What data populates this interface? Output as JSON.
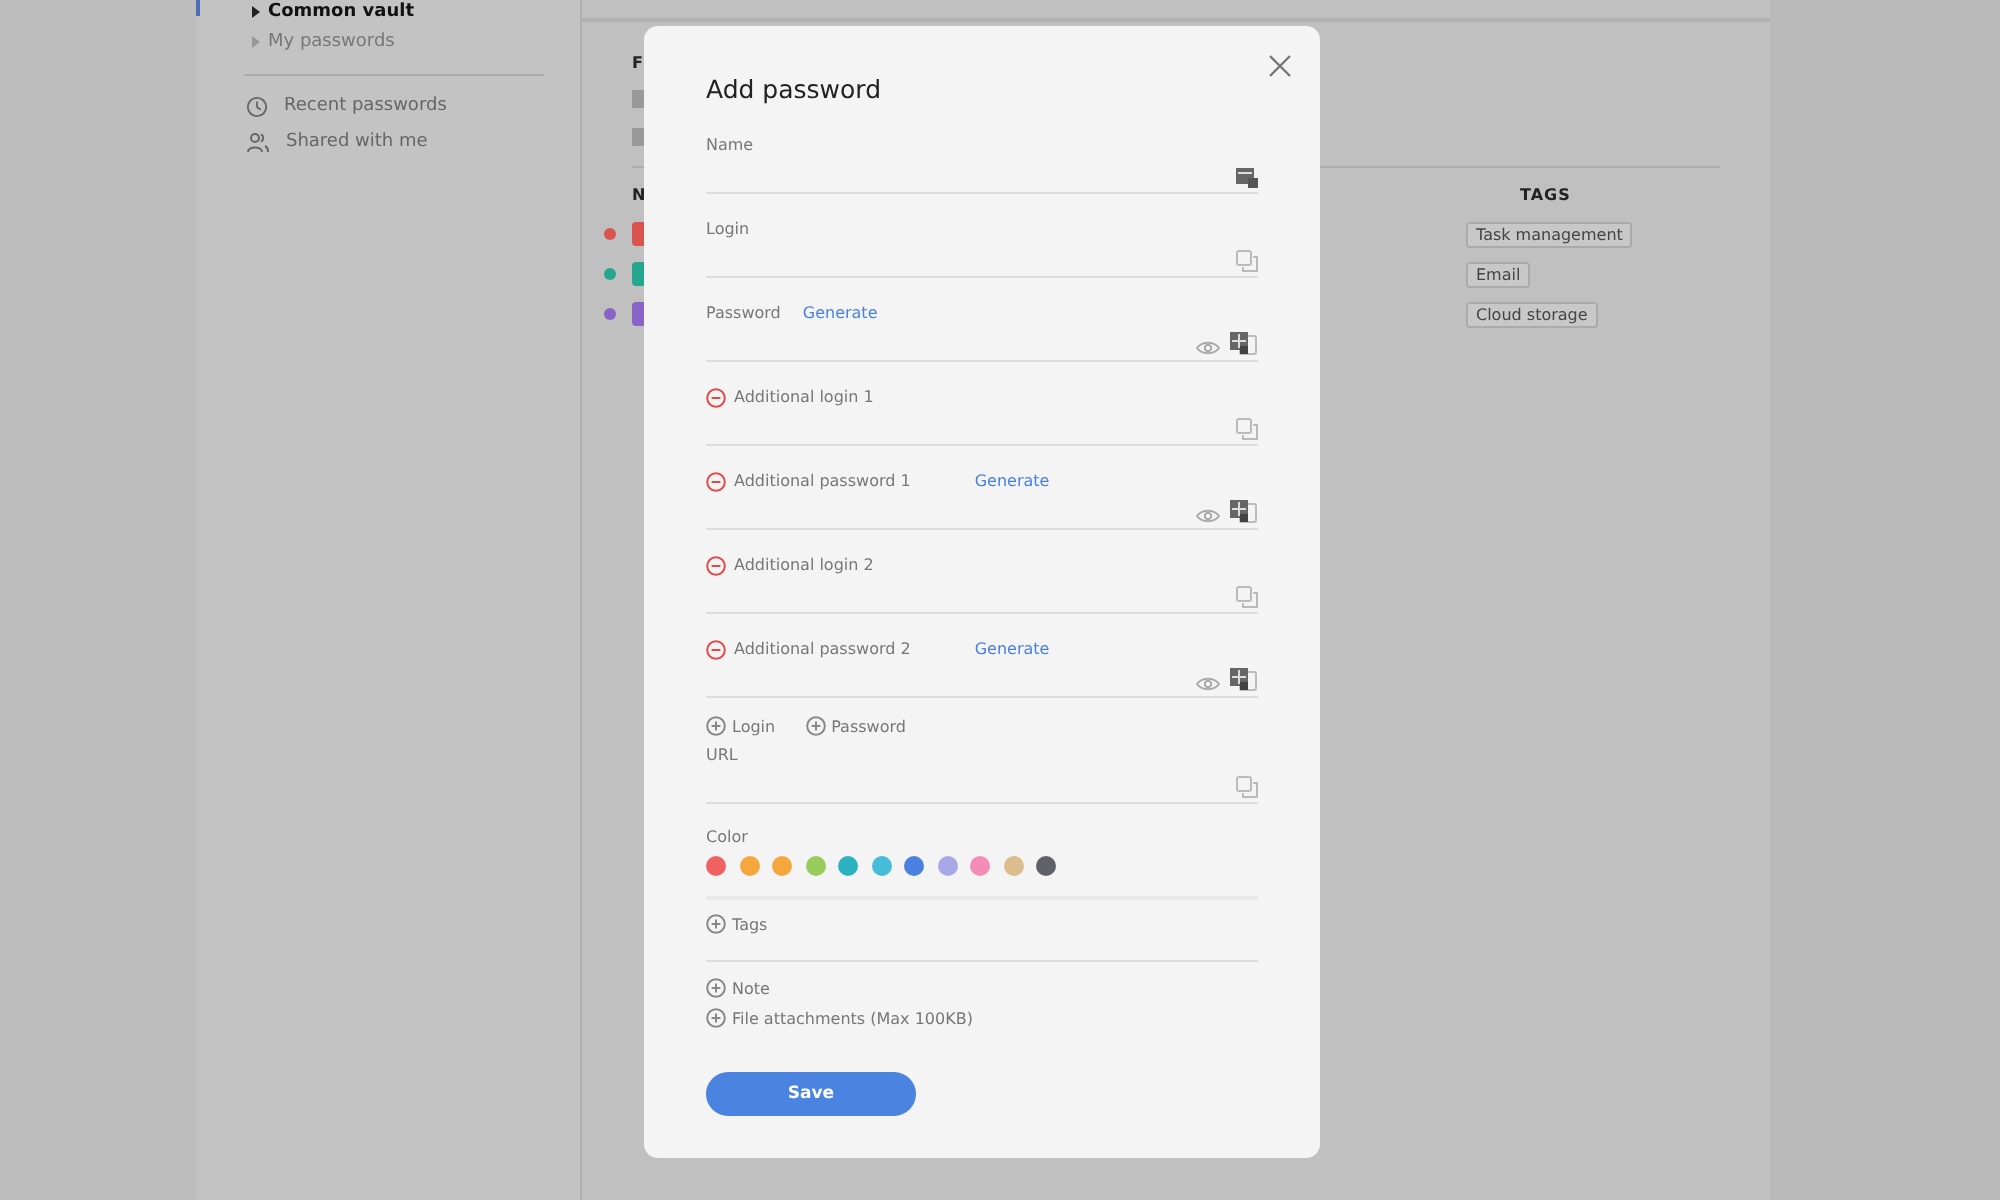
{
  "sidebar": {
    "vaults": [
      {
        "label": "Common vault",
        "selected": true
      },
      {
        "label": "My passwords",
        "selected": false
      }
    ],
    "links": [
      {
        "label": "Recent passwords",
        "kind": "recent"
      },
      {
        "label": "Shared with me",
        "kind": "shared"
      }
    ]
  },
  "main": {
    "folders_heading": "F",
    "list_heading": "N",
    "tags_heading": "TAGS",
    "rows": [
      {
        "color": "#d9534f",
        "tag": "Task management"
      },
      {
        "color": "#26a68f",
        "tag": "Email"
      },
      {
        "color": "#8a63c8",
        "tag": "Cloud storage"
      }
    ]
  },
  "dialog": {
    "title": "Add password",
    "fields": [
      {
        "label": "Name",
        "removable": false,
        "icons": [
          {
            "kind": "generator"
          }
        ]
      },
      {
        "label": "Login",
        "removable": false,
        "icons": [
          {
            "kind": "copy"
          }
        ]
      },
      {
        "label": "Password",
        "removable": false,
        "generate": "Generate",
        "icons": [
          {
            "kind": "eye"
          },
          {
            "kind": "generator-copy"
          }
        ]
      },
      {
        "label": "Additional login 1",
        "removable": true,
        "icons": [
          {
            "kind": "copy"
          }
        ]
      },
      {
        "label": "Additional password 1",
        "removable": true,
        "generate": "Generate",
        "icons": [
          {
            "kind": "eye"
          },
          {
            "kind": "generator-copy"
          }
        ]
      },
      {
        "label": "Additional login 2",
        "removable": true,
        "icons": [
          {
            "kind": "copy"
          }
        ]
      },
      {
        "label": "Additional password 2",
        "removable": true,
        "generate": "Generate",
        "icons": [
          {
            "kind": "eye"
          },
          {
            "kind": "generator-copy"
          }
        ]
      }
    ],
    "add_links": [
      "Login",
      "Password"
    ],
    "url": {
      "label": "URL",
      "icons": [
        {
          "kind": "copy"
        }
      ]
    },
    "color": {
      "label": "Color",
      "swatches": [
        {
          "color": "#f06262"
        },
        {
          "color": "#f5a63c"
        },
        {
          "color": "#f5a63c"
        },
        {
          "color": "#98cc5c"
        },
        {
          "color": "#2cb1c0"
        },
        {
          "color": "#46bcd8"
        },
        {
          "color": "#4a80e0"
        },
        {
          "color": "#a8a8e8"
        },
        {
          "color": "#f48cb8"
        },
        {
          "color": "#dcbd8e"
        },
        {
          "color": "#5f6068"
        }
      ]
    },
    "tags": "Tags",
    "note": "Note",
    "attachments": "File attachments (Max 100KB)",
    "save": "Save"
  }
}
